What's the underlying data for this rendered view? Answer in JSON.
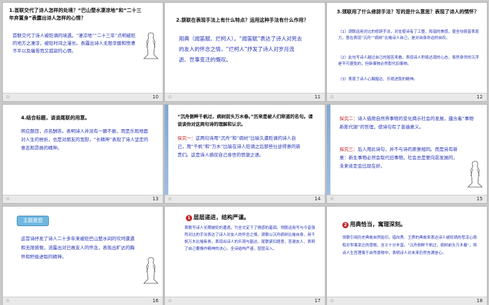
{
  "slides": [
    {
      "num": "10",
      "star": "☆",
      "q": "1.首联交代了诗人怎样的处境？“巴山楚水凄凉地”和“二十三年弃置身”表露出诗人怎样的心情？",
      "a": "首联交代了诗人被贬谪的境遇。“凄凉地”“二十三年”点明被贬的地方之凄凉，被贬时间之漫长。表露出诗人无限辛酸和愤懑不平以及痛苦而又孤寂的心情。"
    },
    {
      "num": "11",
      "star": "☆",
      "q": "2.颔联在表现手法上有什么特点？运用这种手法有什么作用？",
      "a": "用典（闻笛赋、烂柯人）。“闻笛赋”表达了诗人对死去的友人的怀念之情，“烂柯人”抒发了诗人对岁月流逝、世事变迁的慨叹。"
    },
    {
      "num": "12",
      "star": "☆",
      "q": "3.颈联用了什么修辞手法？写的是什么意思？表现了诗人的情怀？",
      "a1": "（1）颈联运用对比的修辞手法，对仗使诗有了工整、和谐的美感，使全句极富表现力，意在表现“沉舟”“病树”比喻诗人自己，是对自身命运的自叹。",
      "a2": "（2）此句写诗人越过自己的困苦来看，表现诗人积极达观的心态，虽然身世的沉浮是不可避免的，但新事物必然取代旧事物。",
      "a3": "（3）表现了诗人心胸豁达、乐观进取的精神。"
    },
    {
      "num": "13",
      "star": "☆",
      "q": "4.结合标题，谈谈尾联的用意。",
      "a": "照应题目，点名酬答。表明诗人并没有一蹶不振，而是乐观地面对人生的挫折，也是对朋友的宽慰，“长精神”表现了诗人坚定的意志和昂扬的精神。"
    },
    {
      "num": "14",
      "star": "☆",
      "q": "“沉舟侧畔千帆过，病树前头万木春。”历来是被人们称道的名句。请谈谈你对这两句诗的理解和认识。",
      "label": "探究一：",
      "a": "这两句诗用“沉舟”和“病树”比喻久遭贬谪的诗人自己，用“千帆”和“万木”比喻在诗人贬谪之后那些仕途得意的新贵们。这是诗人感叹自己身世的愤激之语。"
    },
    {
      "num": "15",
      "star": "☆",
      "label1": "探究二：",
      "a1": "诗人借用自然界事物的变化揭示社会的发展，蕴含着“事物新陈代谢”的哲理，使诗句有了普遍意义。",
      "label2": "探究三：",
      "a2": "后人用此诗句，并不与诗的原意相同。而是另有新意：新生事物必然会取代旧事物，社会总是要向前发展的，未来肯定会比现在好。"
    },
    {
      "num": "16",
      "star": "☆",
      "badge": "主题思想",
      "a": "这首诗抒发了诗人二十多年来被贬巴山楚水间的坎坷遭遇和无限感慨，流露出对已故友人的怀念，表现出旷达的胸怀和积极进取的精神。"
    },
    {
      "num": "17",
      "star": "☆",
      "circ": "1",
      "title": "层层递进，结构严谨。",
      "a": "首联写诗人长期被贬的遭遇，为全文定下了情感的基调。领联运用写与今昔强烈对比的手法表达了诗人对友人的怀念之情，颈联以沉舟病树比喻自身，用千帆万木比喻新贵，表现出诗人的乐观与豁达。尾联紧扣题意，答谢友人，表明了自己要振作精神的决心，全诗结构严谨，层层深入。"
    },
    {
      "num": "18",
      "star": "☆",
      "circ": "2",
      "title": "用典恰当，寓理深刻。",
      "a": "领联引用历史典故自然贴切，借向秀、王质的典故来表达诗人被贬谪的悲凉心境和对世事变迁的感慨，含义十分丰富。“沉舟侧畔千帆过，病树前头万木春”，将诗人生哲理寓于自然景物中，表明诗人对未来仍然充满信心。"
    }
  ]
}
